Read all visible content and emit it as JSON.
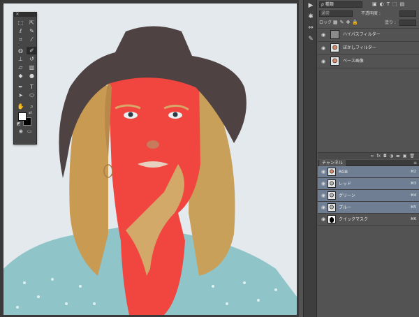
{
  "tools": {
    "close": "×",
    "items": [
      {
        "name": "marquee",
        "glyph": "⬚"
      },
      {
        "name": "move",
        "glyph": "⇱"
      },
      {
        "name": "lasso",
        "glyph": "ℓ"
      },
      {
        "name": "quick-select",
        "glyph": "✎"
      },
      {
        "name": "crop",
        "glyph": "⌗"
      },
      {
        "name": "eyedropper",
        "glyph": "⁄"
      },
      {
        "name": "spot-heal",
        "glyph": "◍"
      },
      {
        "name": "brush",
        "glyph": "✐"
      },
      {
        "name": "stamp",
        "glyph": "⊥"
      },
      {
        "name": "history-brush",
        "glyph": "↺"
      },
      {
        "name": "eraser",
        "glyph": "▱"
      },
      {
        "name": "gradient",
        "glyph": "▥"
      },
      {
        "name": "blur",
        "glyph": "◆"
      },
      {
        "name": "dodge",
        "glyph": "●"
      },
      {
        "name": "pen",
        "glyph": "✒"
      },
      {
        "name": "type",
        "glyph": "T"
      },
      {
        "name": "path-select",
        "glyph": "➤"
      },
      {
        "name": "shape",
        "glyph": "⬭"
      },
      {
        "name": "hand",
        "glyph": "✋"
      },
      {
        "name": "zoom",
        "glyph": "⌕"
      }
    ],
    "swap": "⇄",
    "default_colors": "◩",
    "bottom": [
      "◉",
      "▭"
    ]
  },
  "side_strip": [
    "▶",
    "✱",
    "⇔",
    "✎"
  ],
  "layers": {
    "kind": "ρ 種類",
    "filter_icons": [
      "▣",
      "◐",
      "T",
      "⬚",
      "▤"
    ],
    "blend": "通常",
    "opacity_label": "不透明度 :",
    "opacity_value": "",
    "lock_label": "ロック :",
    "lock_icons": [
      "▦",
      "✎",
      "✥",
      "🔒"
    ],
    "fill_label": "塗り :",
    "fill_value": "",
    "items": [
      {
        "name": "ハイパスフィルター",
        "thumb": "gray",
        "visible": "◉"
      },
      {
        "name": "ぼかしフィルター",
        "thumb": "portrait",
        "visible": "◉"
      },
      {
        "name": "ベース画像",
        "thumb": "portrait",
        "visible": "◉"
      }
    ],
    "footer_icons": [
      "∞",
      "fx",
      "◘",
      "◑",
      "▬",
      "▣",
      "🗑"
    ]
  },
  "channels": {
    "tab": "チャンネル",
    "menu": "≡",
    "items": [
      {
        "name": "RGB",
        "shortcut": "⌘2",
        "selected": true,
        "thumb": "rgb"
      },
      {
        "name": "レッド",
        "shortcut": "⌘3",
        "selected": true,
        "thumb": "ch"
      },
      {
        "name": "グリーン",
        "shortcut": "⌘4",
        "selected": true,
        "thumb": "ch"
      },
      {
        "name": "ブルー",
        "shortcut": "⌘5",
        "selected": true,
        "thumb": "ch"
      },
      {
        "name": "クイックマスク",
        "shortcut": "⌘6",
        "selected": false,
        "thumb": "mask"
      }
    ]
  },
  "colors": {
    "canvas_bg": "#e3e9ec",
    "mask_red": "#f0463f",
    "selected_row": "#6f7e93"
  }
}
